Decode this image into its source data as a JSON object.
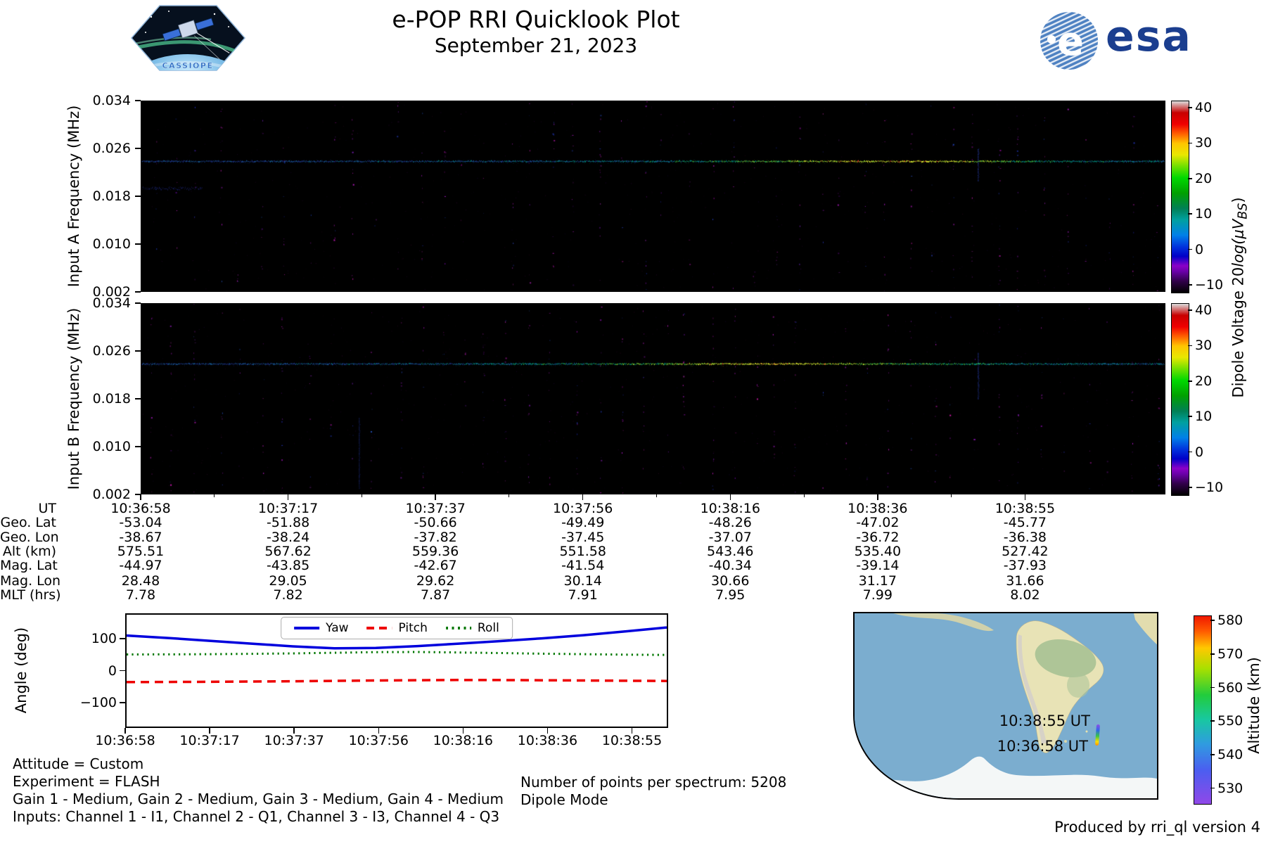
{
  "header": {
    "title": "e-POP RRI Quicklook Plot",
    "subtitle": "September 21, 2023",
    "cassiope_text": "CASSIOPE",
    "esa_wordmark": "esa"
  },
  "colors": {
    "yaw_blue": "#0000dd",
    "pitch_red": "#ee0000",
    "roll_green": "#007700",
    "esa_blue": "#1b3e8f",
    "ocean": "#7badcf",
    "land": "#e8e3b6",
    "background": "#ffffff"
  },
  "colorbar_label": {
    "prefix": "Dipole Voltage 20",
    "math": "log(μV",
    "sub": "BS",
    "suffix": ")"
  },
  "chart_data": [
    {
      "type": "heatmap",
      "id": "input-a-spectrogram",
      "ylabel": "Input A Frequency (MHz)",
      "yticks": [
        "0.034",
        "0.026",
        "0.018",
        "0.010",
        "0.002"
      ],
      "ylim": [
        0.002,
        0.034
      ],
      "xticks": [
        "10:36:58",
        "10:37:17",
        "10:37:37",
        "10:37:56",
        "10:38:16",
        "10:38:36",
        "10:38:55"
      ],
      "background": "black",
      "emission_line": {
        "freq_mhz": 0.024,
        "y_frac": 0.318,
        "profile": [
          0.26,
          0.27,
          0.28,
          0.3,
          0.32,
          0.33,
          0.34,
          0.36,
          0.38,
          0.42,
          0.48,
          0.56,
          0.66,
          0.78,
          0.92,
          0.96,
          0.88,
          0.62,
          0.52,
          0.46,
          0.42
        ]
      },
      "features": {
        "smudges": [
          {
            "x0": 0.0,
            "x1": 0.06,
            "y": 0.456
          }
        ],
        "streaks": [
          {
            "x": 0.817,
            "y0": 0.25,
            "y1": 0.42,
            "a": 0.8
          }
        ]
      },
      "colorbar": {
        "label": "Dipole Voltage 20log(μV_BS)",
        "labels": [
          "40",
          "30",
          "20",
          "10",
          "0",
          "−10"
        ],
        "values": [
          40,
          30,
          20,
          10,
          0,
          -10
        ],
        "lim": [
          -12,
          42
        ]
      },
      "seed": 12345
    },
    {
      "type": "heatmap",
      "id": "input-b-spectrogram",
      "ylabel": "Input B Frequency (MHz)",
      "yticks": [
        "0.034",
        "0.026",
        "0.018",
        "0.010",
        "0.002"
      ],
      "ylim": [
        0.002,
        0.034
      ],
      "xticks": [
        "10:36:58",
        "10:37:17",
        "10:37:37",
        "10:37:56",
        "10:38:16",
        "10:38:36",
        "10:38:55"
      ],
      "background": "black",
      "emission_line": {
        "freq_mhz": 0.024,
        "y_frac": 0.318,
        "profile": [
          0.25,
          0.27,
          0.3,
          0.32,
          0.34,
          0.36,
          0.4,
          0.44,
          0.5,
          0.58,
          0.68,
          0.82,
          0.95,
          0.9,
          0.78,
          0.64,
          0.56,
          0.5,
          0.46,
          0.42,
          0.38
        ]
      },
      "features": {
        "smudges": [],
        "streaks": [
          {
            "x": 0.213,
            "y0": 0.6,
            "y1": 0.97,
            "a": 0.5
          },
          {
            "x": 0.817,
            "y0": 0.26,
            "y1": 0.5,
            "a": 0.8
          }
        ]
      },
      "colorbar": {
        "label": "Dipole Voltage 20log(μV_BS)",
        "labels": [
          "40",
          "30",
          "20",
          "10",
          "0",
          "−10"
        ],
        "values": [
          40,
          30,
          20,
          10,
          0,
          -10
        ],
        "lim": [
          -12,
          42
        ]
      },
      "seed": 67890
    },
    {
      "type": "line",
      "id": "attitude-plot",
      "ylabel": "Angle (deg)",
      "ylim": [
        -180,
        180
      ],
      "yticks": {
        "labels": [
          "100",
          "0",
          "−100"
        ],
        "values": [
          100,
          0,
          -100
        ]
      },
      "xticks": [
        "10:36:58",
        "10:37:17",
        "10:37:37",
        "10:37:56",
        "10:38:16",
        "10:38:36",
        "10:38:55"
      ],
      "legend": [
        "Yaw",
        "Pitch",
        "Roll"
      ],
      "legend_position": "top-center",
      "x_fracs": [
        0,
        0.0769,
        0.1538,
        0.2308,
        0.3077,
        0.3846,
        0.4615,
        0.5385,
        0.6154,
        0.6923,
        0.7692,
        0.8462,
        0.9231,
        1.0
      ],
      "series": [
        {
          "name": "Yaw",
          "color": "#0000dd",
          "style": "solid",
          "values": [
            113,
            105,
            96,
            87,
            78,
            72,
            73,
            79,
            87,
            95,
            104,
            114,
            126,
            139
          ]
        },
        {
          "name": "Pitch",
          "color": "#ee0000",
          "style": "dashed",
          "values": [
            -37,
            -36.5,
            -36,
            -35.2,
            -34.2,
            -33,
            -31.8,
            -30.8,
            -30.2,
            -30.4,
            -31,
            -31.8,
            -32.6,
            -33.2
          ]
        },
        {
          "name": "Roll",
          "color": "#007700",
          "style": "dotted",
          "values": [
            52,
            52.4,
            53,
            54,
            55.5,
            57.5,
            59.5,
            60,
            58.5,
            56.5,
            54.5,
            53,
            51.5,
            50.6
          ]
        }
      ]
    },
    {
      "type": "map",
      "id": "ground-track-map",
      "region": "South America / South Atlantic",
      "labels": [
        {
          "text": "10:38:55 UT"
        },
        {
          "text": "10:36:58 UT"
        }
      ],
      "track": {
        "start_alt_km": 575.51,
        "end_alt_km": 527.42
      },
      "colorbar": {
        "label": "Altitude (km)",
        "labels": [
          "580",
          "570",
          "560",
          "550",
          "540",
          "530"
        ],
        "values": [
          580,
          570,
          560,
          550,
          540,
          530
        ],
        "lim": [
          525.5,
          581.5
        ]
      }
    }
  ],
  "ephemeris": {
    "rows": [
      {
        "label": "UT",
        "values": [
          "10:36:58",
          "10:37:17",
          "10:37:37",
          "10:37:56",
          "10:38:16",
          "10:38:36",
          "10:38:55"
        ]
      },
      {
        "label": "Geo. Lat",
        "values": [
          "-53.04",
          "-51.88",
          "-50.66",
          "-49.49",
          "-48.26",
          "-47.02",
          "-45.77"
        ]
      },
      {
        "label": "Geo. Lon",
        "values": [
          "-38.67",
          "-38.24",
          "-37.82",
          "-37.45",
          "-37.07",
          "-36.72",
          "-36.38"
        ]
      },
      {
        "label": "Alt (km)",
        "values": [
          "575.51",
          "567.62",
          "559.36",
          "551.58",
          "543.46",
          "535.40",
          "527.42"
        ]
      },
      {
        "label": "Mag. Lat",
        "values": [
          "-44.97",
          "-43.85",
          "-42.67",
          "-41.54",
          "-40.34",
          "-39.14",
          "-37.93"
        ]
      },
      {
        "label": "Mag. Lon",
        "values": [
          "28.48",
          "29.05",
          "29.62",
          "30.14",
          "30.66",
          "31.17",
          "31.66"
        ]
      },
      {
        "label": "MLT (hrs)",
        "values": [
          "7.78",
          "7.82",
          "7.87",
          "7.91",
          "7.95",
          "7.99",
          "8.02"
        ]
      }
    ]
  },
  "annotations": {
    "attitude": "Attitude = Custom",
    "experiment": "Experiment = FLASH",
    "gains": "Gain 1 - Medium, Gain 2 - Medium, Gain 3 - Medium, Gain 4 - Medium",
    "inputs": "Inputs: Channel 1 - I1, Channel 2 - Q1, Channel 3 - I3, Channel 4 - Q3",
    "points_per_spectrum": "Number of points per spectrum: 5208",
    "mode": "Dipole Mode",
    "produced_by": "Produced by rri_ql version 4"
  }
}
